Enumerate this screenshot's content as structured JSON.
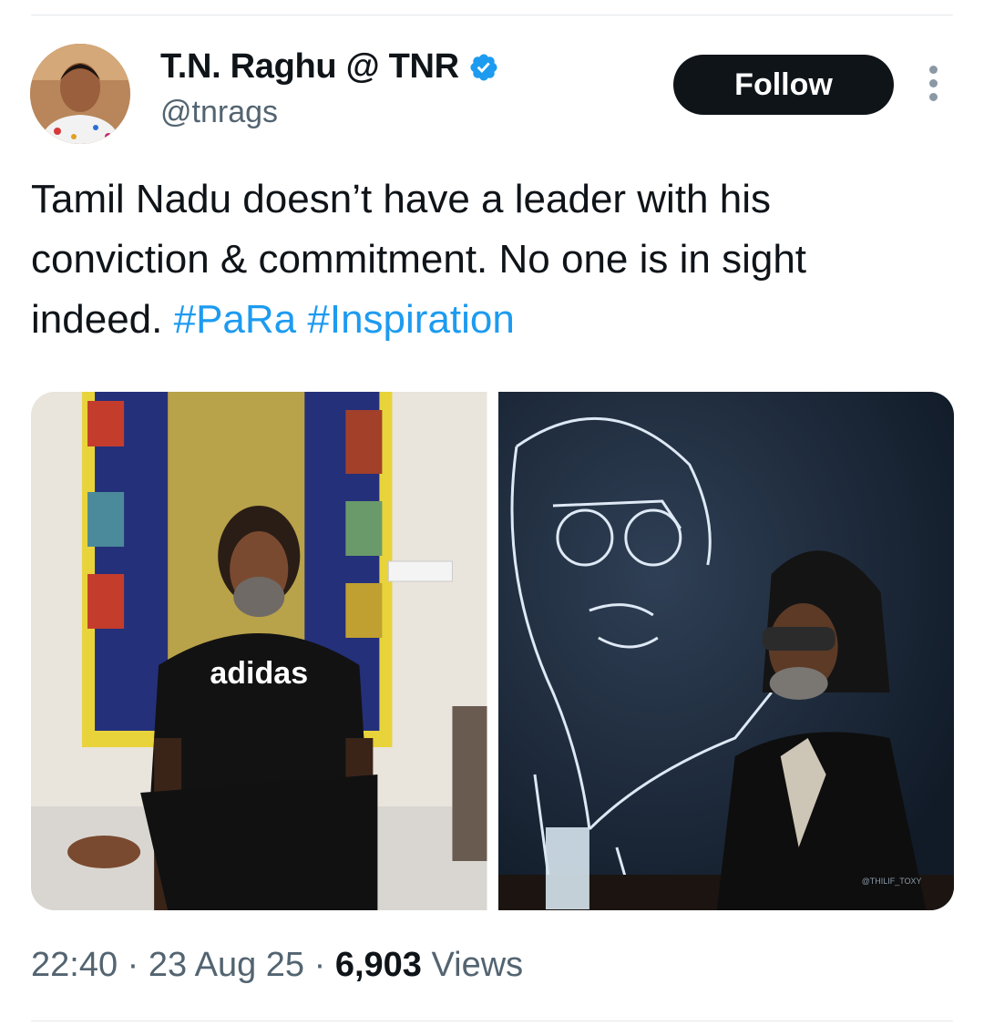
{
  "author": {
    "display_name": "T.N. Raghu @ TNR",
    "handle": "@tnrags",
    "verified": true,
    "avatar_icon": "profile-photo"
  },
  "actions": {
    "follow_label": "Follow",
    "more_icon": "more-vertical-icon"
  },
  "tweet": {
    "line1": "Tamil Nadu doesn’t have a leader with his",
    "line2": "conviction & commitment. No one is in sight",
    "line3_text": "indeed.",
    "hashtags": [
      "#PaRa",
      "#Inspiration"
    ]
  },
  "media": [
    {
      "description_icon": "photo",
      "logo_text": "adidas"
    },
    {
      "description_icon": "photo",
      "watermark": "@THILIF_TOXY"
    }
  ],
  "meta": {
    "time": "22:40",
    "date": "23 Aug 25",
    "views_count": "6,903",
    "views_label": "Views",
    "separator": "·"
  },
  "colors": {
    "link": "#1d9bf0",
    "text": "#0f1419",
    "secondary": "#536471",
    "follow_bg": "#0f1419"
  }
}
